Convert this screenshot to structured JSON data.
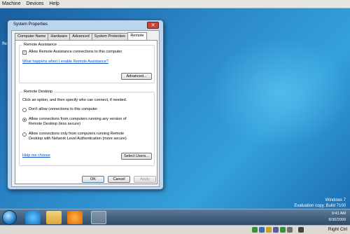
{
  "vm_menu": {
    "machine": "Machine",
    "devices": "Devices",
    "help": "Help"
  },
  "desktop": {
    "recycle_label": "Re",
    "watermark": {
      "line1": "Windows 7",
      "line2": "Evaluation copy. Build 7100"
    }
  },
  "dialog": {
    "title": "System Properties",
    "tabs": [
      "Computer Name",
      "Hardware",
      "Advanced",
      "System Protection",
      "Remote"
    ],
    "active_tab": "Remote",
    "remote_assistance": {
      "group_label": "Remote Assistance",
      "allow_checkbox_label": "Allow Remote Assistance connections to this computer",
      "allow_checked": true,
      "help_link": "What happens when I enable Remote Assistance?",
      "advanced_button": "Advanced..."
    },
    "remote_desktop": {
      "group_label": "Remote Desktop",
      "instruction": "Click an option, and then specify who can connect, if needed.",
      "option1": "Don't allow connections to this computer",
      "option2_line1": "Allow connections from computers running any version of",
      "option2_line2": "Remote Desktop (less secure)",
      "option3_line1": "Allow connections only from computers running Remote",
      "option3_line2": "Desktop with Network Level Authentication (more secure)",
      "selected_option": 2,
      "help_link": "Help me choose",
      "select_users_button": "Select Users..."
    },
    "buttons": {
      "ok": "OK",
      "cancel": "Cancel",
      "apply": "Apply"
    }
  },
  "taskbar": {
    "time": "9:41 AM",
    "date": "8/30/2009"
  },
  "statusbar": {
    "host_key": "Right Ctrl"
  },
  "colors": {
    "accent": "#0a4fc4",
    "desktop": "#2d78b9"
  }
}
